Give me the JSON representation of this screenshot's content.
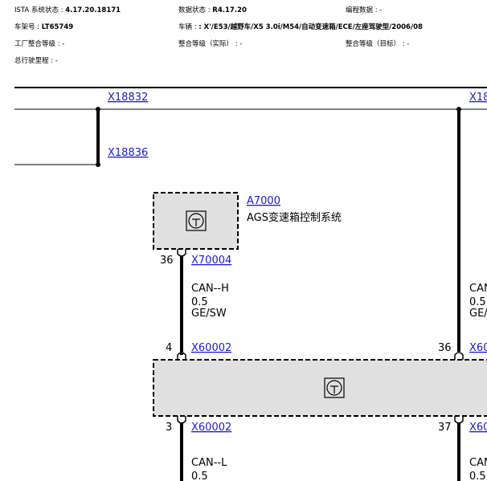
{
  "header": {
    "ista_label": "ISTA 系统状态 :",
    "ista_value": "4.17.20.18171",
    "data_label": "数据状态 :",
    "data_value": "R4.17.20",
    "prog_data": "编程数据 : -",
    "vin_label": "车架号 :",
    "vin_value": "LT65749",
    "vehicle_label": "车辆 :",
    "vehicle_value": ": X'/E53/越野车/X5 3.0i/M54/自动变速箱/ECE/左座驾驶型/2006/08",
    "factory_level": "工厂整合等级 : -",
    "actual_level": "整合等级（实际） : -",
    "target_level": "整合等级（目标） : -",
    "mileage": "总行驶里程 : -"
  },
  "diagram": {
    "top_connector_left": "X18832",
    "top_connector_right": "X18",
    "branch_connector": "X18836",
    "module_id": "A7000",
    "module_name": "AGS变速箱控制系统",
    "pin_module": "36",
    "conn_module": "X70004",
    "wire_left_top": {
      "signal": "CAN--H",
      "size": "0.5",
      "color": "GE/SW"
    },
    "wire_right_top": {
      "signal": "CAN",
      "size": "0.5",
      "color": "GE/"
    },
    "pin_bus_left_top": "4",
    "conn_bus_left_top": "X60002",
    "pin_bus_right_top": "36",
    "conn_bus_right_top": "X60",
    "pin_bus_left_bottom": "3",
    "conn_bus_left_bottom": "X60002",
    "pin_bus_right_bottom": "37",
    "conn_bus_right_bottom": "X60",
    "wire_left_bottom": {
      "signal": "CAN--L",
      "size": "0.5"
    },
    "wire_right_bottom": {
      "signal": "CAN",
      "size": "0.5"
    },
    "colors": {
      "link": "#1a1ad4",
      "box_fill": "#e0e0e0",
      "line": "#000000"
    },
    "icons": [
      "ecu-icon",
      "ecu-icon"
    ]
  }
}
